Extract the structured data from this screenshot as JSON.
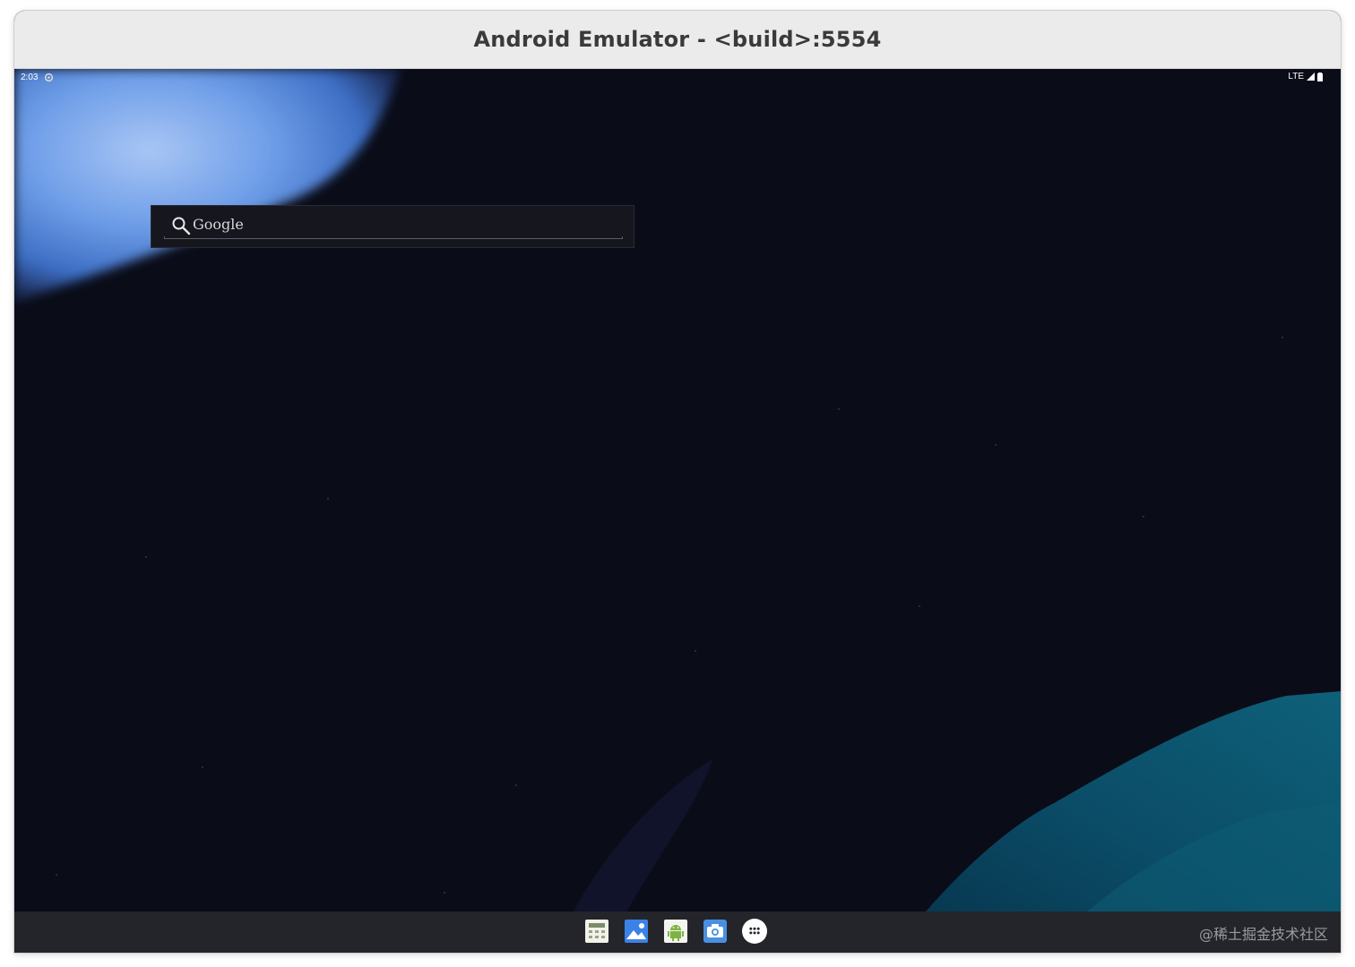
{
  "window": {
    "title": "Android Emulator - <build>:5554"
  },
  "statusbar": {
    "time": "2:03",
    "network": "LTE",
    "settings_icon": "gear-icon",
    "signal_icon": "signal-icon",
    "battery_icon": "battery-icon"
  },
  "search_widget": {
    "label": "Google",
    "icon": "search-icon"
  },
  "dock": {
    "items": [
      {
        "name": "calculator-app-icon",
        "color": "#f2f2e8"
      },
      {
        "name": "gallery-app-icon",
        "color": "#3b82e6"
      },
      {
        "name": "android-app-icon",
        "color": "#7cb342"
      },
      {
        "name": "camera-app-icon",
        "color": "#4a90e2"
      },
      {
        "name": "app-drawer-icon",
        "color": "#ffffff"
      }
    ]
  },
  "watermark": "@稀土掘金技术社区",
  "colors": {
    "titlebar": "#ebebeb",
    "wallpaper": "#0a0c18",
    "taskbar": "#24252b",
    "accent_blue": "#6f9ee8",
    "accent_teal": "#0d5a73"
  }
}
